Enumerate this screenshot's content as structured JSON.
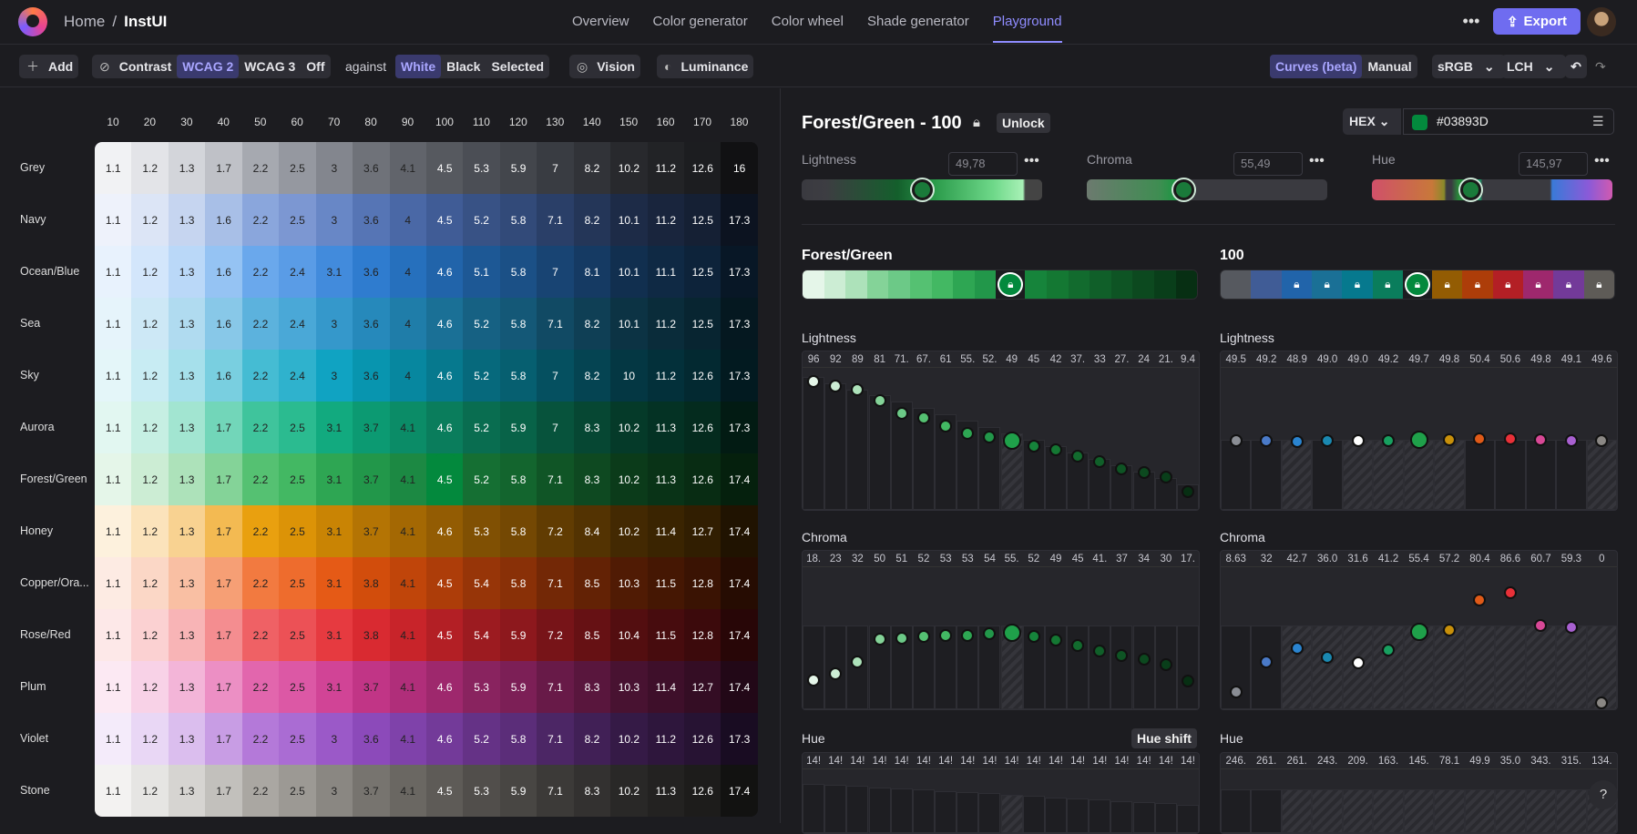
{
  "app": {
    "home": "Home",
    "separator": "/",
    "project": "InstUI"
  },
  "nav": [
    "Overview",
    "Color generator",
    "Color wheel",
    "Shade generator",
    "Playground"
  ],
  "nav_active": "Playground",
  "header_actions": {
    "more": "•••",
    "export": "Export"
  },
  "toolbar": {
    "add": "Add",
    "contrast": "Contrast",
    "wcag2": "WCAG 2",
    "wcag3": "WCAG 3",
    "off": "Off",
    "against": "against",
    "white": "White",
    "black": "Black",
    "selected": "Selected",
    "vision": "Vision",
    "luminance": "Luminance",
    "curves": "Curves (beta)",
    "manual": "Manual",
    "colorspace": "sRGB",
    "model": "LCH"
  },
  "grid": {
    "columns": [
      "10",
      "20",
      "30",
      "40",
      "50",
      "60",
      "70",
      "80",
      "90",
      "100",
      "110",
      "120",
      "130",
      "140",
      "150",
      "160",
      "170",
      "180"
    ],
    "rows": [
      {
        "name": "Grey",
        "values": [
          "1.1",
          "1.2",
          "1.3",
          "1.7",
          "2.2",
          "2.5",
          "3",
          "3.6",
          "4.1",
          "4.5",
          "5.3",
          "5.9",
          "7",
          "8.2",
          "10.2",
          "11.2",
          "12.6",
          "16"
        ]
      },
      {
        "name": "Navy",
        "values": [
          "1.1",
          "1.2",
          "1.3",
          "1.6",
          "2.2",
          "2.5",
          "3",
          "3.6",
          "4",
          "4.5",
          "5.2",
          "5.8",
          "7.1",
          "8.2",
          "10.1",
          "11.2",
          "12.5",
          "17.3"
        ]
      },
      {
        "name": "Ocean/Blue",
        "values": [
          "1.1",
          "1.2",
          "1.3",
          "1.6",
          "2.2",
          "2.4",
          "3.1",
          "3.6",
          "4",
          "4.6",
          "5.1",
          "5.8",
          "7",
          "8.1",
          "10.1",
          "11.1",
          "12.5",
          "17.3"
        ]
      },
      {
        "name": "Sea",
        "values": [
          "1.1",
          "1.2",
          "1.3",
          "1.6",
          "2.2",
          "2.4",
          "3",
          "3.6",
          "4",
          "4.6",
          "5.2",
          "5.8",
          "7.1",
          "8.2",
          "10.1",
          "11.2",
          "12.5",
          "17.3"
        ]
      },
      {
        "name": "Sky",
        "values": [
          "1.1",
          "1.2",
          "1.3",
          "1.6",
          "2.2",
          "2.4",
          "3",
          "3.6",
          "4",
          "4.6",
          "5.2",
          "5.8",
          "7",
          "8.2",
          "10",
          "11.2",
          "12.6",
          "17.3"
        ]
      },
      {
        "name": "Aurora",
        "values": [
          "1.1",
          "1.2",
          "1.3",
          "1.7",
          "2.2",
          "2.5",
          "3.1",
          "3.7",
          "4.1",
          "4.6",
          "5.2",
          "5.9",
          "7",
          "8.3",
          "10.2",
          "11.3",
          "12.6",
          "17.3"
        ]
      },
      {
        "name": "Forest/Green",
        "values": [
          "1.1",
          "1.2",
          "1.3",
          "1.7",
          "2.2",
          "2.5",
          "3.1",
          "3.7",
          "4.1",
          "4.5",
          "5.2",
          "5.8",
          "7.1",
          "8.3",
          "10.2",
          "11.3",
          "12.6",
          "17.4"
        ]
      },
      {
        "name": "Honey",
        "values": [
          "1.1",
          "1.2",
          "1.3",
          "1.7",
          "2.2",
          "2.5",
          "3.1",
          "3.7",
          "4.1",
          "4.6",
          "5.3",
          "5.8",
          "7.2",
          "8.4",
          "10.2",
          "11.4",
          "12.7",
          "17.4"
        ]
      },
      {
        "name": "Copper/Ora...",
        "values": [
          "1.1",
          "1.2",
          "1.3",
          "1.7",
          "2.2",
          "2.5",
          "3.1",
          "3.8",
          "4.1",
          "4.5",
          "5.4",
          "5.8",
          "7.1",
          "8.5",
          "10.3",
          "11.5",
          "12.8",
          "17.4"
        ]
      },
      {
        "name": "Rose/Red",
        "values": [
          "1.1",
          "1.2",
          "1.3",
          "1.7",
          "2.2",
          "2.5",
          "3.1",
          "3.8",
          "4.1",
          "4.5",
          "5.4",
          "5.9",
          "7.2",
          "8.5",
          "10.4",
          "11.5",
          "12.8",
          "17.4"
        ]
      },
      {
        "name": "Plum",
        "values": [
          "1.1",
          "1.2",
          "1.3",
          "1.7",
          "2.2",
          "2.5",
          "3.1",
          "3.7",
          "4.1",
          "4.6",
          "5.3",
          "5.9",
          "7.1",
          "8.3",
          "10.3",
          "11.4",
          "12.7",
          "17.4"
        ]
      },
      {
        "name": "Violet",
        "values": [
          "1.1",
          "1.2",
          "1.3",
          "1.7",
          "2.2",
          "2.5",
          "3",
          "3.6",
          "4.1",
          "4.6",
          "5.2",
          "5.8",
          "7.1",
          "8.2",
          "10.2",
          "11.2",
          "12.6",
          "17.3"
        ]
      },
      {
        "name": "Stone",
        "values": [
          "1.1",
          "1.2",
          "1.3",
          "1.7",
          "2.2",
          "2.5",
          "3",
          "3.7",
          "4.1",
          "4.5",
          "5.3",
          "5.9",
          "7.1",
          "8.3",
          "10.2",
          "11.3",
          "12.6",
          "17.4"
        ]
      }
    ],
    "row_colors": [
      [
        "#f1f2f4",
        "#e3e4e8",
        "#d3d5da",
        "#bfc1c7",
        "#a6a9b0",
        "#9598a0",
        "#83868e",
        "#6f7279",
        "#61646b",
        "#56595f",
        "#4b4e55",
        "#43464c",
        "#393c42",
        "#313338",
        "#28292d",
        "#222326",
        "#1c1d20",
        "#111113"
      ],
      [
        "#eef2fb",
        "#dce5f6",
        "#c6d5f0",
        "#a8bfe7",
        "#8aa6dc",
        "#7c97d2",
        "#6887c6",
        "#5675b5",
        "#4a68a6",
        "#405c96",
        "#385285",
        "#324a79",
        "#2a3f68",
        "#243658",
        "#1d2b47",
        "#19253d",
        "#152034",
        "#0c1320"
      ],
      [
        "#e8f2fd",
        "#d3e6fb",
        "#bad8f8",
        "#95c3f3",
        "#6aa8ec",
        "#5a9ce6",
        "#428bdc",
        "#2f7ccf",
        "#2670bd",
        "#2164aa",
        "#1d5895",
        "#1b5086",
        "#184473",
        "#153a63",
        "#112f4f",
        "#0f2944",
        "#0d233a",
        "#081726"
      ],
      [
        "#e6f4fb",
        "#cde8f6",
        "#b0dbf0",
        "#88c8e8",
        "#5cb2dd",
        "#4aa8d7",
        "#3598cb",
        "#2689bb",
        "#1f7da9",
        "#1a7096",
        "#166183",
        "#145877",
        "#114a64",
        "#0f3f55",
        "#0c3344",
        "#0a2c3a",
        "#082531",
        "#051820"
      ],
      [
        "#e4f6f9",
        "#c8ecf3",
        "#a6e0eb",
        "#79cfe0",
        "#45bcd3",
        "#2fb2cd",
        "#10a3c2",
        "#0895af",
        "#07879f",
        "#06798e",
        "#06697c",
        "#065f70",
        "#055060",
        "#054452",
        "#043743",
        "#03303a",
        "#032931",
        "#021a20"
      ],
      [
        "#e2f7f1",
        "#c6efe3",
        "#a2e5d1",
        "#72d6b9",
        "#3fc49c",
        "#2bbb90",
        "#12aa7f",
        "#0c9a72",
        "#0b8c67",
        "#0a7d5c",
        "#096d50",
        "#086348",
        "#07533c",
        "#064733",
        "#053a29",
        "#043224",
        "#042b1e",
        "#021b13"
      ],
      [
        "#e5f6e9",
        "#ccedd4",
        "#ade2ba",
        "#84d398",
        "#55c172",
        "#43b863",
        "#2ea653",
        "#22974a",
        "#1c8943",
        "#03893D",
        "#156f33",
        "#13652e",
        "#105526",
        "#0e4921",
        "#0b3b1a",
        "#093317",
        "#082c13",
        "#05200d"
      ],
      [
        "#fdf1dd",
        "#fbe3bb",
        "#f8d291",
        "#f3ba52",
        "#e9a00f",
        "#dc9307",
        "#c98404",
        "#b47404",
        "#a46803",
        "#935c03",
        "#805003",
        "#744803",
        "#613c02",
        "#533302",
        "#432902",
        "#3a2401",
        "#311e01",
        "#201301"
      ],
      [
        "#fdebe3",
        "#fbd7c6",
        "#f9bfa3",
        "#f69f75",
        "#f27a40",
        "#ee6c2d",
        "#e55a16",
        "#d24d0c",
        "#c0450a",
        "#ad3d09",
        "#973508",
        "#893007",
        "#732806",
        "#632205",
        "#501b04",
        "#451703",
        "#3a1303",
        "#260c02"
      ],
      [
        "#fde8e8",
        "#fbd1d2",
        "#f8b4b6",
        "#f48d90",
        "#ef6165",
        "#ec5156",
        "#e63a40",
        "#d92a31",
        "#c8242a",
        "#b31f25",
        "#9c1b20",
        "#8d181d",
        "#771418",
        "#661114",
        "#530e10",
        "#470c0e",
        "#3c0a0c",
        "#280607"
      ],
      [
        "#fce9f3",
        "#f8d2e7",
        "#f3b5d8",
        "#ec8fc4",
        "#e266ad",
        "#dc58a5",
        "#d14496",
        "#c13586",
        "#b02e7a",
        "#9e286d",
        "#89235f",
        "#7c1f56",
        "#681a48",
        "#59163d",
        "#481231",
        "#3e0f2a",
        "#340d24",
        "#220817"
      ],
      [
        "#f4ebfa",
        "#e9d7f5",
        "#dbbeee",
        "#c89de4",
        "#b479d9",
        "#aa6cd3",
        "#9b59c8",
        "#8c4aba",
        "#7f42aa",
        "#733a99",
        "#653286",
        "#5b2d79",
        "#4c2665",
        "#412056",
        "#351a46",
        "#2e163c",
        "#271333",
        "#190c22"
      ],
      [
        "#f3f2f1",
        "#e6e5e3",
        "#d6d4d1",
        "#c2c0bc",
        "#aaa7a2",
        "#9c9994",
        "#8a8782",
        "#77746f",
        "#6a6762",
        "#5e5b57",
        "#514e4b",
        "#484643",
        "#3c3a38",
        "#333130",
        "#292827",
        "#232221",
        "#1d1c1b",
        "#121211"
      ]
    ],
    "dark_text_from_col": 9,
    "highlight": {
      "row": 6,
      "col": 9
    }
  },
  "panel": {
    "title": "Forest/Green - 100",
    "unlock": "Unlock",
    "format": "HEX",
    "hex": "#03893D",
    "sliders": [
      {
        "label": "Lightness",
        "value": "49,78",
        "pos": 0.5
      },
      {
        "label": "Chroma",
        "value": "55,49",
        "pos": 0.4
      },
      {
        "label": "Hue",
        "value": "145,97",
        "pos": 0.41
      }
    ],
    "swatch_left_title": "Forest/Green",
    "swatch_right_title": "100",
    "left_strip": [
      "#e5f6e9",
      "#ccedd4",
      "#ade2ba",
      "#84d398",
      "#6cc987",
      "#55c172",
      "#43b863",
      "#2ea653",
      "#22974a",
      "#03893D",
      "#16843b",
      "#147833",
      "#126b2e",
      "#105f29",
      "#0e5424",
      "#0c491f",
      "#093e1a",
      "#072f13"
    ],
    "left_strip_selected": 9,
    "right_strip": [
      "#56595f",
      "#405c96",
      "#2164aa",
      "#1a7096",
      "#06798e",
      "#0a7d5c",
      "#03893D",
      "#935c03",
      "#ad3d09",
      "#b31f25",
      "#9e286d",
      "#733a99",
      "#5e5b57"
    ],
    "right_strip_selected": 6,
    "right_strip_locked": [
      2,
      3,
      4,
      5,
      7,
      8,
      9,
      10,
      11,
      12
    ],
    "plots": {
      "left_lightness": {
        "title": "Lightness",
        "nums": [
          "96",
          "92",
          "89",
          "81",
          "71.",
          "67.",
          "61",
          "55.",
          "52.",
          "49",
          "45",
          "42",
          "37.",
          "33",
          "27.",
          "24",
          "21.",
          "9.4"
        ]
      },
      "right_lightness": {
        "title": "Lightness",
        "nums": [
          "49.5",
          "49.2",
          "48.9",
          "49.0",
          "49.0",
          "49.2",
          "49.7",
          "49.8",
          "50.4",
          "50.6",
          "49.8",
          "49.1",
          "49.6"
        ]
      },
      "left_chroma": {
        "title": "Chroma",
        "nums": [
          "18.",
          "23",
          "32",
          "50",
          "51",
          "52",
          "53",
          "53",
          "54",
          "55.",
          "52",
          "49",
          "45",
          "41.",
          "37",
          "34",
          "30",
          "17."
        ]
      },
      "right_chroma": {
        "title": "Chroma",
        "nums": [
          "8.63",
          "32",
          "42.7",
          "36.0",
          "31.6",
          "41.2",
          "55.4",
          "57.2",
          "80.4",
          "86.6",
          "60.7",
          "59.3",
          "0"
        ]
      },
      "left_hue": {
        "title": "Hue",
        "nums": [
          "14!",
          "14!",
          "14!",
          "14!",
          "14!",
          "14!",
          "14!",
          "14!",
          "14!",
          "14!",
          "14!",
          "14!",
          "14!",
          "14!",
          "14!",
          "14!",
          "14!",
          "14!"
        ]
      },
      "right_hue": {
        "title": "Hue",
        "nums": [
          "246.",
          "261.",
          "261.",
          "243.",
          "209.",
          "163.",
          "145.",
          "78.1",
          "49.9",
          "35.0",
          "343.",
          "315.",
          "134."
        ]
      }
    },
    "hue_shift": "Hue shift",
    "chart_values": {
      "left_lightness": [
        96,
        92,
        89,
        81,
        71,
        67,
        61,
        55,
        52,
        49,
        45,
        42,
        37,
        33,
        27,
        24,
        21,
        9.4
      ],
      "right_lightness": [
        49.5,
        49.2,
        48.9,
        49.0,
        49.0,
        49.2,
        49.7,
        49.8,
        50.4,
        50.6,
        49.8,
        49.1,
        49.6
      ],
      "left_chroma": [
        18,
        23,
        32,
        50,
        51,
        52,
        53,
        53,
        54,
        55,
        52,
        49,
        45,
        41,
        37,
        34,
        30,
        17
      ],
      "right_chroma": [
        8.63,
        32,
        42.7,
        36.0,
        31.6,
        41.2,
        55.4,
        57.2,
        80.4,
        86.6,
        60.7,
        59.3,
        0
      ]
    }
  },
  "help": "?"
}
